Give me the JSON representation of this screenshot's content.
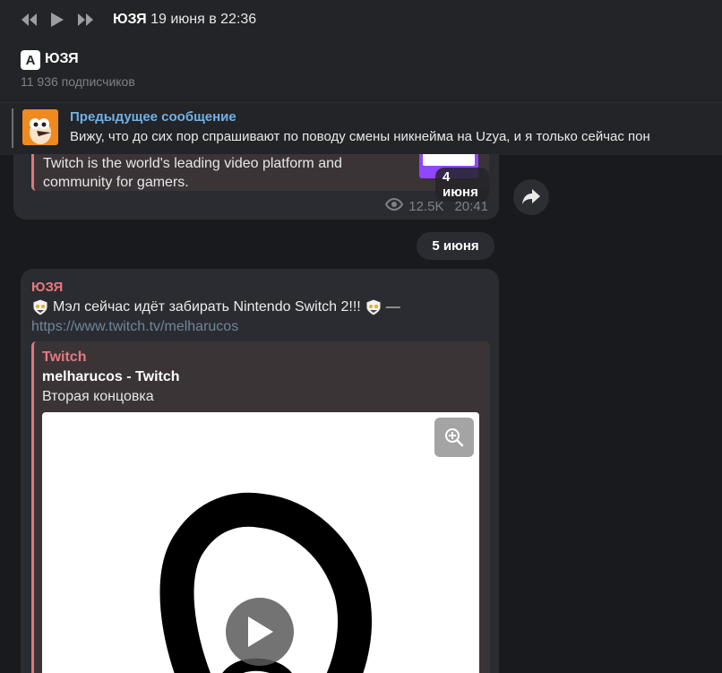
{
  "player": {
    "title": "ЮЗЯ",
    "date": "19 июня в 22:36"
  },
  "channel": {
    "logo_text": "A",
    "name": "ЮЗЯ",
    "subscribers": "11 936 подписчиков"
  },
  "pinned": {
    "label": "Предыдущее сообщение",
    "text": "Вижу, что до сих пор спрашивают по поводу смены никнейма на Uzya, и я только сейчас пон"
  },
  "prev_post": {
    "embed_text_line1": "Twitch is the world's leading video platform and",
    "embed_text_line2": "community for gamers.",
    "date_badge": "4 июня",
    "views": "12.5K",
    "time": "20:41"
  },
  "date_separator": "5 июня",
  "post": {
    "author": "ЮЗЯ",
    "text_main": "Мэл сейчас идёт забирать Nintendo Switch 2!!!",
    "text_dash": "—",
    "link": "https://www.twitch.tv/melharucos",
    "embed": {
      "site": "Twitch",
      "title": "melharucos - Twitch",
      "description": "Вторая концовка"
    }
  },
  "colors": {
    "accent_link": "#6fb1e8",
    "author": "#e9787e",
    "background": "#181a1e",
    "bubble": "#2a2c31"
  }
}
